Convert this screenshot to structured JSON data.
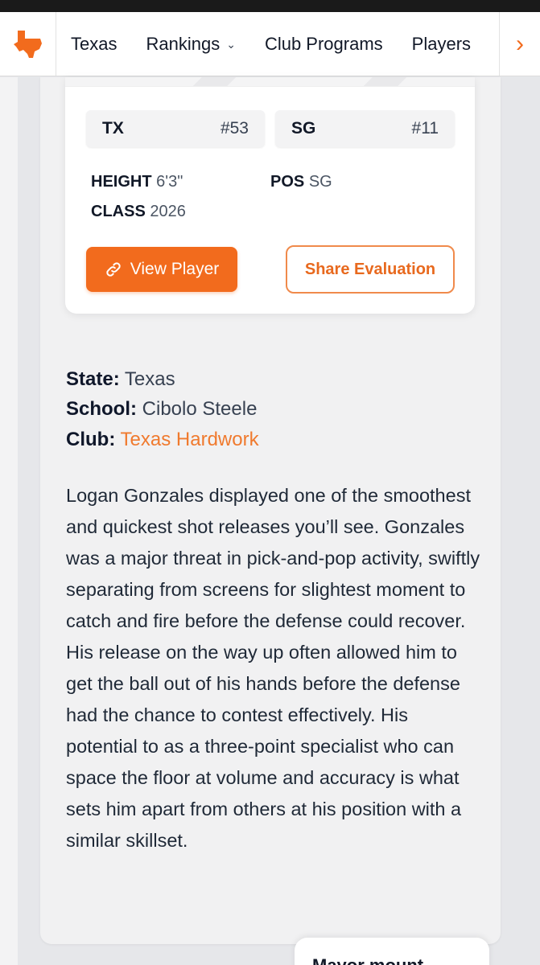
{
  "nav": {
    "logo_icon": "texas-state-icon",
    "items": [
      {
        "label": "Texas",
        "has_dropdown": false
      },
      {
        "label": "Rankings",
        "has_dropdown": true
      },
      {
        "label": "Club Programs",
        "has_dropdown": false
      },
      {
        "label": "Players",
        "has_dropdown": false
      }
    ],
    "scroll_icon": "chevron-right-icon"
  },
  "player_card": {
    "state_rank": {
      "label": "TX",
      "value": "#53"
    },
    "position_rank": {
      "label": "SG",
      "value": "#11"
    },
    "height": {
      "label": "HEIGHT",
      "value": "6'3\""
    },
    "class": {
      "label": "CLASS",
      "value": "2026"
    },
    "position": {
      "label": "POS",
      "value": "SG"
    },
    "view_button": "View Player",
    "share_button": "Share Evaluation"
  },
  "details": {
    "state": {
      "label": "State:",
      "value": "Texas"
    },
    "school": {
      "label": "School:",
      "value": "Cibolo Steele"
    },
    "club": {
      "label": "Club:",
      "value": "Texas Hardwork"
    }
  },
  "bio": "Logan Gonzales displayed one of the smoothest and quickest shot releases you’ll see. Gonzales was a major threat in pick-and-pop activity, swiftly separating from screens for slightest moment to catch and fire before the defense could recover. His release on the way up often allowed him to get the ball out of his hands before the defense had the chance to contest effectively. His potential to as a three-point specialist who can space the floor at volume and accuracy is what sets him apart from others at his position with a similar skillset.",
  "bottom_card_text": "Mayor mount",
  "colors": {
    "accent": "#f26b1d",
    "link": "#f07a2e",
    "background": "#e6e7ea"
  }
}
